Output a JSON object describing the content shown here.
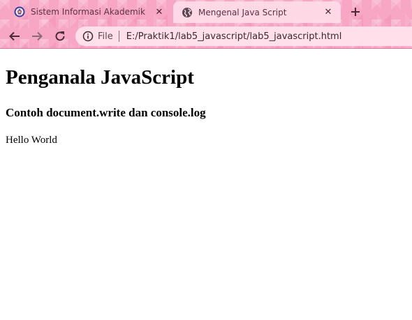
{
  "tabs": [
    {
      "title": "Sistem Informasi Akademik",
      "favicon": "university-logo-icon",
      "active": false
    },
    {
      "title": "Mengenal Java Script",
      "favicon": "globe-icon",
      "active": true
    }
  ],
  "toolbar": {
    "back_icon": "back-arrow-icon",
    "forward_icon": "forward-arrow-icon",
    "reload_icon": "reload-icon",
    "scheme": "File",
    "url": "E:/Praktik1/lab5_javascript/lab5_javascript.html"
  },
  "page": {
    "heading": "Penganala JavaScript",
    "subheading": "Contoh document.write dan console.log",
    "body_text": "Hello World"
  },
  "colors": {
    "chrome_accent": "#f7a7c4",
    "active_tab": "#ffdce8",
    "icon": "#4a2a38"
  }
}
